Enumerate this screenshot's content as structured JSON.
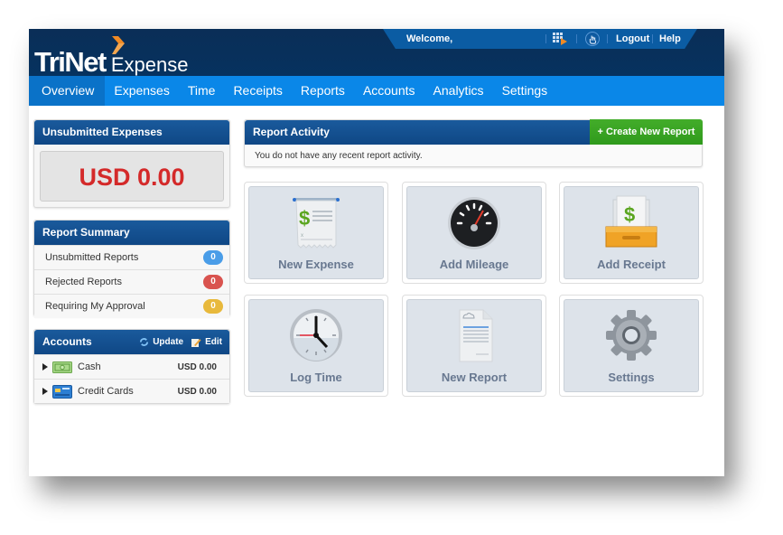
{
  "brand": {
    "name": "TriNet",
    "product": "Expense",
    "accent": "#f08a24"
  },
  "topbar": {
    "welcome": "Welcome,",
    "logout": "Logout",
    "help": "Help",
    "icons": [
      "apps-grid-icon",
      "touch-icon"
    ]
  },
  "nav": {
    "active": "Overview",
    "items": [
      {
        "label": "Overview"
      },
      {
        "label": "Expenses"
      },
      {
        "label": "Time"
      },
      {
        "label": "Receipts"
      },
      {
        "label": "Reports"
      },
      {
        "label": "Accounts"
      },
      {
        "label": "Analytics"
      },
      {
        "label": "Settings"
      }
    ]
  },
  "unsubmitted": {
    "title": "Unsubmitted Expenses",
    "amount": "USD 0.00",
    "amount_color": "#d42a2a"
  },
  "report_summary": {
    "title": "Report Summary",
    "rows": [
      {
        "label": "Unsubmitted Reports",
        "count": "0",
        "color": "#4a9de8"
      },
      {
        "label": "Rejected Reports",
        "count": "0",
        "color": "#d9534f"
      },
      {
        "label": "Requiring My Approval",
        "count": "0",
        "color": "#e8b93c"
      }
    ]
  },
  "accounts": {
    "title": "Accounts",
    "update_label": "Update",
    "edit_label": "Edit",
    "rows": [
      {
        "name": "Cash",
        "amount": "USD 0.00",
        "icon": "cash-icon"
      },
      {
        "name": "Credit Cards",
        "amount": "USD 0.00",
        "icon": "credit-card-icon"
      }
    ]
  },
  "report_activity": {
    "title": "Report Activity",
    "create_label": "+ Create New Report",
    "empty_text": "You do not have any recent report activity."
  },
  "tiles": [
    {
      "label": "New Expense",
      "icon": "receipt-dollar-icon"
    },
    {
      "label": "Add Mileage",
      "icon": "speedometer-icon"
    },
    {
      "label": "Add Receipt",
      "icon": "receipt-tray-icon"
    },
    {
      "label": "Log Time",
      "icon": "clock-icon"
    },
    {
      "label": "New Report",
      "icon": "report-document-icon"
    },
    {
      "label": "Settings",
      "icon": "gear-icon"
    }
  ]
}
